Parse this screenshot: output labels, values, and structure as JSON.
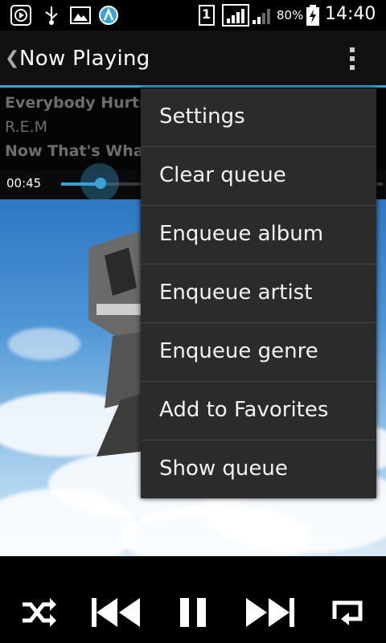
{
  "status_bar": {
    "sim_slot": "1",
    "battery": "80%",
    "time": "14:40",
    "icons": [
      "play-circle-icon",
      "usb-icon",
      "image-icon",
      "app-icon",
      "sim-icon",
      "signal-icon",
      "signal-2-icon",
      "battery-icon"
    ]
  },
  "header": {
    "title": "Now Playing"
  },
  "track": {
    "title": "Everybody Hurts",
    "artist": "R.E.M",
    "album": "Now That's What"
  },
  "playback": {
    "elapsed": "00:45",
    "progress_fraction": 0.12
  },
  "menu": {
    "items": [
      {
        "label": "Settings"
      },
      {
        "label": "Clear queue"
      },
      {
        "label": "Enqueue album"
      },
      {
        "label": "Enqueue artist"
      },
      {
        "label": "Enqueue genre"
      },
      {
        "label": "Add to Favorites"
      },
      {
        "label": "Show queue"
      }
    ]
  },
  "controls": [
    "shuffle-icon",
    "previous-icon",
    "pause-icon",
    "next-icon",
    "repeat-icon"
  ],
  "colors": {
    "accent": "#3aa3d6",
    "menu_bg": "#2b2b2b",
    "action_bar": "#111111"
  }
}
